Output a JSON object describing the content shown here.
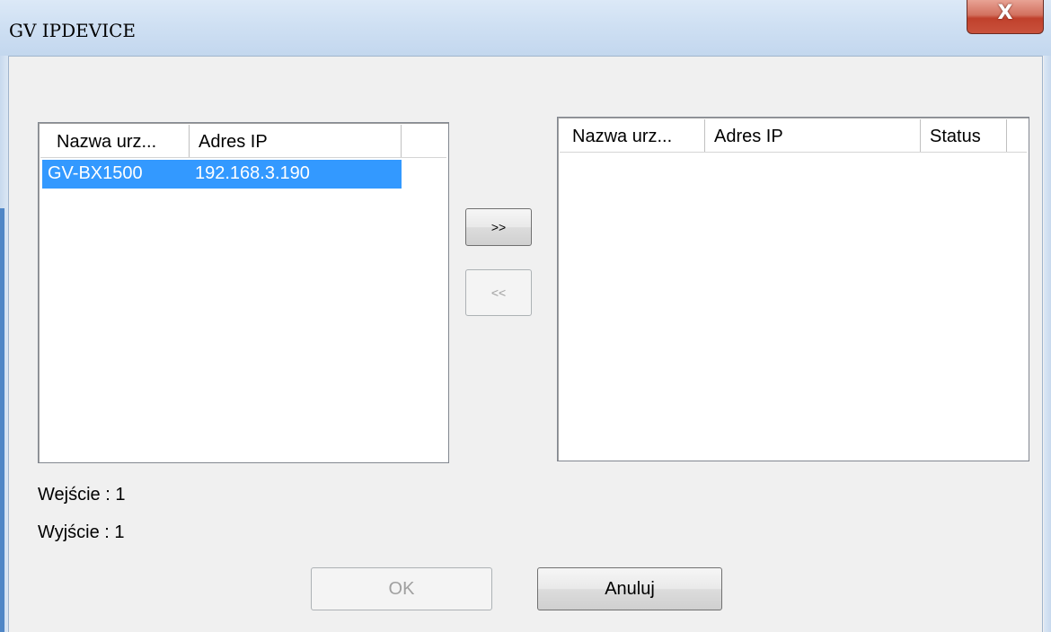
{
  "window": {
    "title": "GV IPDEVICE",
    "close_label": "X"
  },
  "left_list": {
    "columns": [
      "Nazwa urz...",
      "Adres IP",
      ""
    ],
    "rows": [
      {
        "name": "GV-BX1500",
        "ip": "192.168.3.190",
        "selected": true
      }
    ]
  },
  "right_list": {
    "columns": [
      "Nazwa urz...",
      "Adres IP",
      "Status",
      ""
    ],
    "rows": []
  },
  "transfer": {
    "add_label": ">>",
    "remove_label": "<<"
  },
  "counts": {
    "input_label": "Wejście : 1",
    "output_label": "Wyjście : 1"
  },
  "footer": {
    "ok_label": "OK",
    "cancel_label": "Anuluj"
  }
}
